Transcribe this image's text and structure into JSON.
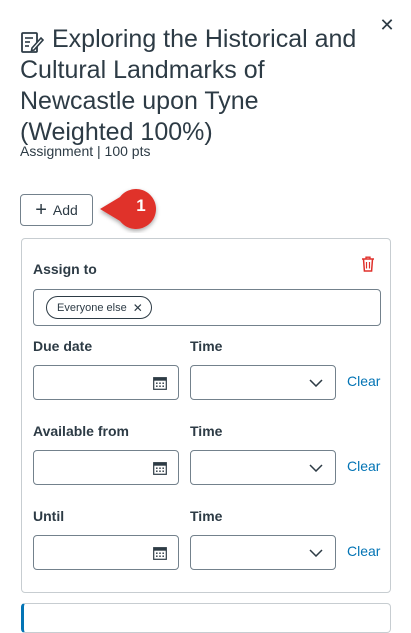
{
  "header": {
    "title": "Exploring the Historical and Cultural Landmarks of Newcastle upon Tyne (Weighted 100%)",
    "meta": "Assignment | 100 pts",
    "close_icon": "✕"
  },
  "toolbar": {
    "add_label": "Add",
    "callout_number": "1"
  },
  "assign_card": {
    "assign_to_label": "Assign to",
    "chips": [
      {
        "label": "Everyone else",
        "remove": "✕"
      }
    ],
    "rows": [
      {
        "date_label": "Due date",
        "time_label": "Time",
        "date_value": "",
        "time_value": "",
        "clear_label": "Clear"
      },
      {
        "date_label": "Available from",
        "time_label": "Time",
        "date_value": "",
        "time_value": "",
        "clear_label": "Clear"
      },
      {
        "date_label": "Until",
        "time_label": "Time",
        "date_value": "",
        "time_value": "",
        "clear_label": "Clear"
      }
    ]
  },
  "colors": {
    "text": "#2d3b45",
    "link": "#0374b5",
    "callout": "#e0302b",
    "delete": "#e0302b",
    "border": "#73818c"
  },
  "icons": {
    "title": "edit-document-icon",
    "close": "close-icon",
    "add": "plus-icon",
    "delete": "trash-icon",
    "calendar": "calendar-icon",
    "dropdown": "chevron-down-icon"
  }
}
